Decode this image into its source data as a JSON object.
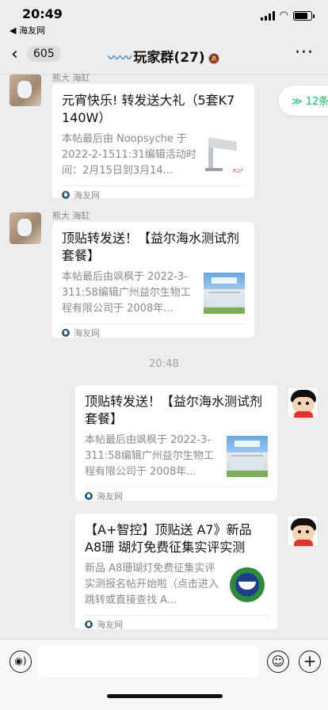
{
  "status_bar": {
    "time": "20:49",
    "back_app": "◀ 海友网"
  },
  "nav": {
    "back_count": "605",
    "title": "玩家群(27)"
  },
  "unread_pill": "≫ 12条",
  "messages": [
    {
      "sender": "熊大 海缸",
      "title": "元宵快乐! 转发送大礼（5套K7 140W）",
      "desc": "本帖最后由 Noopsyche 于 2022-2-1511:31编辑活动时间：2月15日到3月14...",
      "source": "海友网",
      "thumb_icon": "lamp-product-image",
      "thumb_tag": "R2F"
    },
    {
      "sender": "熊大 海缸",
      "title": "顶贴转发送！【益尔海水测试剂套餐】",
      "desc": "本帖最后由飒枫于 2022-3-311:58编辑广州益尔生物工程有限公司于 2008年...",
      "source": "海友网",
      "thumb_icon": "building-photo"
    },
    {
      "title": "顶贴转发送！【益尔海水测试剂套餐】",
      "desc": "本帖最后由飒枫于 2022-3-311:58编辑广州益尔生物工程有限公司于 2008年...",
      "source": "海友网",
      "thumb_icon": "building-photo"
    },
    {
      "title": "【A+智控】顶贴送 A7》新品A8珊 瑚灯免费征集实评实测",
      "desc": "新品 A8珊瑚灯免费征集实评实测报名帖开始啦（点击进入跳转或直接查找 A...",
      "source": "海友网",
      "thumb_icon": "aquarium-logo"
    }
  ],
  "timestamp": "20:48",
  "icons": {
    "voice": "voice-icon",
    "emoji": "emoji-icon",
    "plus": "plus-icon"
  },
  "colors": {
    "accent_green": "#07c160",
    "background": "#ededed"
  }
}
